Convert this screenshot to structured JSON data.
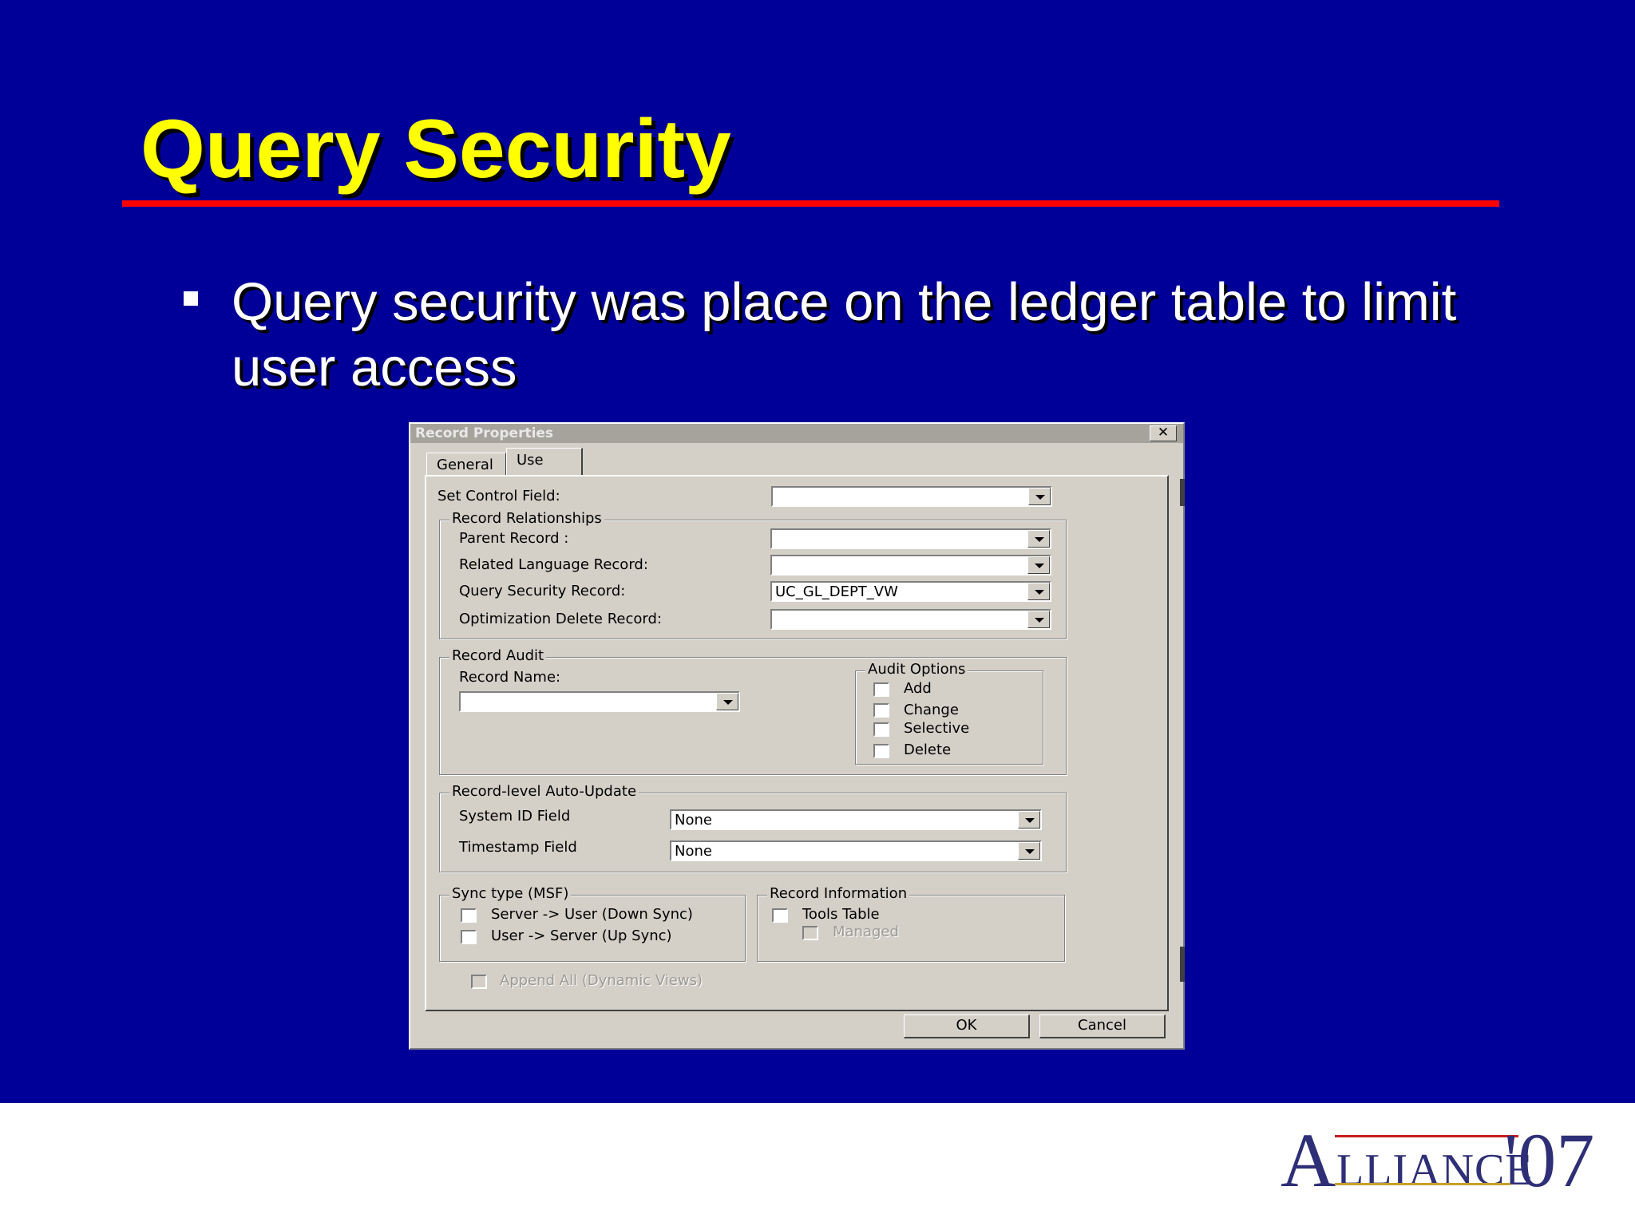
{
  "slide": {
    "title": "Query Security",
    "bullet": "Query security was place on the ledger table to limit user access"
  },
  "colors": {
    "background": "#000099",
    "title": "#ffff00",
    "rule": "#ff0000",
    "dialog_face": "#d4d0c8"
  },
  "dialog": {
    "title": "Record Properties",
    "close_glyph": "✕",
    "tabs": [
      "General",
      "Use"
    ],
    "active_tab": "Use",
    "set_control_field": {
      "label": "Set Control Field:",
      "value": ""
    },
    "record_relationships": {
      "legend": "Record Relationships",
      "parent_record": {
        "label": "Parent Record :",
        "value": ""
      },
      "related_language_record": {
        "label": "Related Language Record:",
        "value": ""
      },
      "query_security_record": {
        "label": "Query Security Record:",
        "value": "UC_GL_DEPT_VW"
      },
      "optimization_delete_record": {
        "label": "Optimization Delete Record:",
        "value": ""
      }
    },
    "record_audit": {
      "legend": "Record Audit",
      "record_name": {
        "label": "Record Name:",
        "value": ""
      },
      "audit_options": {
        "legend": "Audit Options",
        "items": [
          "Add",
          "Change",
          "Selective",
          "Delete"
        ]
      }
    },
    "auto_update": {
      "legend": "Record-level Auto-Update",
      "system_id_field": {
        "label": "System ID Field",
        "value": "None"
      },
      "timestamp_field": {
        "label": "Timestamp Field",
        "value": "None"
      }
    },
    "sync_type": {
      "legend": "Sync type (MSF)",
      "items": [
        "Server -> User (Down Sync)",
        "User -> Server (Up Sync)"
      ]
    },
    "record_information": {
      "legend": "Record Information",
      "tools_table": "Tools Table",
      "managed": "Managed"
    },
    "append_all": "Append All (Dynamic Views)",
    "buttons": {
      "ok": "OK",
      "cancel": "Cancel"
    }
  },
  "logo": {
    "big_a": "A",
    "rest": "LLIANCE",
    "year": "'07"
  }
}
